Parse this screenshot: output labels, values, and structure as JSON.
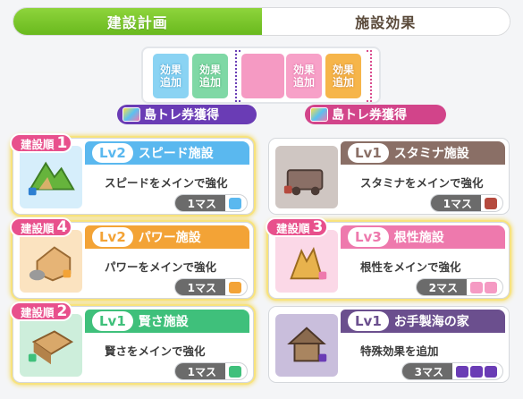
{
  "tabs": [
    {
      "label": "建設計画",
      "active": true
    },
    {
      "label": "施設効果",
      "active": false
    }
  ],
  "slots": [
    {
      "label": "効果\n追加",
      "line1": "効果",
      "line2": "追加",
      "color": "#8ad3f3"
    },
    {
      "label": "効果\n追加",
      "line1": "効果",
      "line2": "追加",
      "color": "#7fd8a5"
    },
    {
      "line1": "効果",
      "line2": "追加",
      "color": "#f7a1c8"
    },
    {
      "line1": "効果",
      "line2": "追加",
      "color": "#f6b54a"
    }
  ],
  "tickets": [
    {
      "label": "島トレ券獲得",
      "color": "#6a3cb5"
    },
    {
      "label": "島トレ券獲得",
      "color": "#d2448a"
    }
  ],
  "cards": [
    {
      "order_label": "建設順",
      "order": "1",
      "level": "Lv2",
      "title": "スピード施設",
      "desc": "スピードをメインで強化",
      "mass": "1マス",
      "color": "#5ab8ef",
      "box_color": "#5ab8ef",
      "boxes": 1,
      "built": true
    },
    {
      "order_label": "",
      "order": "",
      "level": "Lv1",
      "title": "スタミナ施設",
      "desc": "スタミナをメインで強化",
      "mass": "1マス",
      "color": "#8a6f66",
      "box_color": "#b54a3e",
      "boxes": 1,
      "built": false
    },
    {
      "order_label": "建設順",
      "order": "4",
      "level": "Lv2",
      "title": "パワー施設",
      "desc": "パワーをメインで強化",
      "mass": "1マス",
      "color": "#f3a336",
      "box_color": "#f3a336",
      "boxes": 1,
      "built": true
    },
    {
      "order_label": "建設順",
      "order": "3",
      "level": "Lv3",
      "title": "根性施設",
      "desc": "根性をメインで強化",
      "mass": "2マス",
      "color": "#ee79ad",
      "box_color": "#f59ac3",
      "boxes": 2,
      "built": true
    },
    {
      "order_label": "建設順",
      "order": "2",
      "level": "Lv1",
      "title": "賢さ施設",
      "desc": "賢さをメインで強化",
      "mass": "1マス",
      "color": "#3fc07b",
      "box_color": "#3fc07b",
      "boxes": 1,
      "built": true
    },
    {
      "order_label": "",
      "order": "",
      "level": "Lv1",
      "title": "お手製海の家",
      "desc": "特殊効果を追加",
      "mass": "3マス",
      "color": "#6b4f8e",
      "box_color": "#6a3cb5",
      "boxes": 3,
      "built": false
    }
  ]
}
